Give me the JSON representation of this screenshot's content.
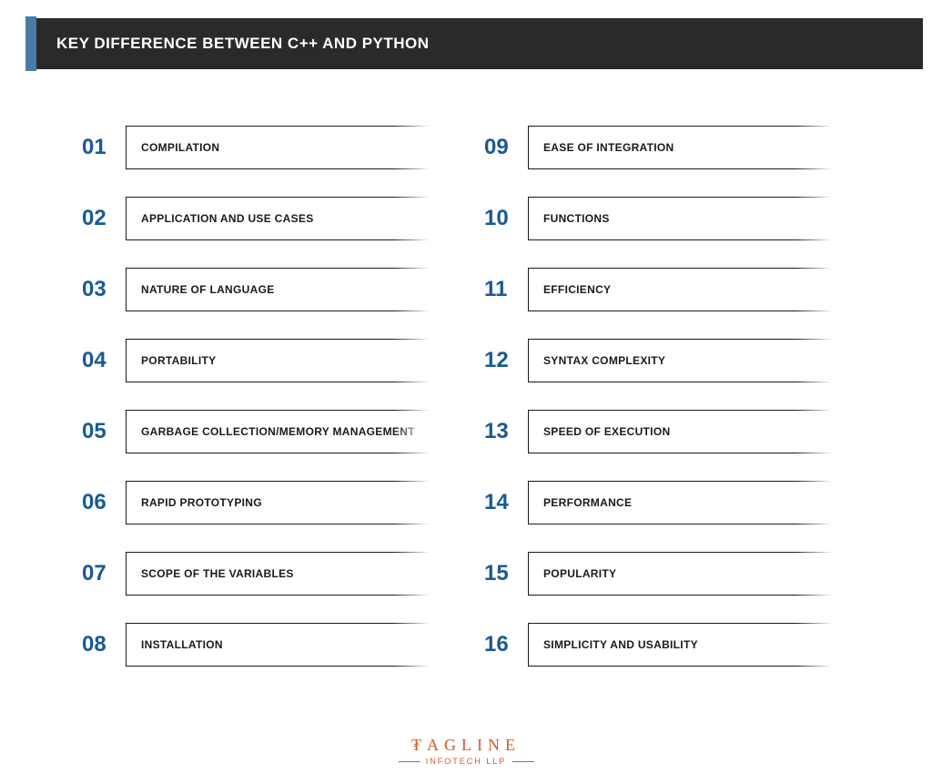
{
  "header": {
    "title": "KEY DIFFERENCE BETWEEN C++ AND PYTHON"
  },
  "leftItems": [
    {
      "num": "01",
      "label": "COMPILATION"
    },
    {
      "num": "02",
      "label": "APPLICATION AND USE CASES"
    },
    {
      "num": "03",
      "label": "NATURE OF LANGUAGE"
    },
    {
      "num": "04",
      "label": "PORTABILITY"
    },
    {
      "num": "05",
      "label": "GARBAGE COLLECTION/MEMORY MANAGEMENT"
    },
    {
      "num": "06",
      "label": "RAPID PROTOTYPING"
    },
    {
      "num": "07",
      "label": "SCOPE OF THE VARIABLES"
    },
    {
      "num": "08",
      "label": "INSTALLATION"
    }
  ],
  "rightItems": [
    {
      "num": "09",
      "label": "EASE OF INTEGRATION"
    },
    {
      "num": "10",
      "label": "FUNCTIONS"
    },
    {
      "num": "11",
      "label": "EFFICIENCY"
    },
    {
      "num": "12",
      "label": "SYNTAX COMPLEXITY"
    },
    {
      "num": "13",
      "label": "SPEED OF EXECUTION"
    },
    {
      "num": "14",
      "label": "PERFORMANCE"
    },
    {
      "num": "15",
      "label": "POPULARITY"
    },
    {
      "num": "16",
      "label": "SIMPLICITY AND USABILITY"
    }
  ],
  "logo": {
    "top": "₮AGLINE",
    "bottom": "INFOTECH LLP"
  }
}
